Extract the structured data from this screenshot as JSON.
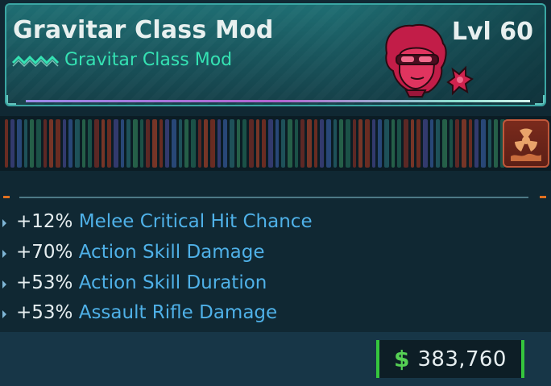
{
  "item": {
    "name": "Gravitar Class Mod",
    "type_label": "Gravitar Class Mod",
    "level_text": "Lvl 60"
  },
  "icons": {
    "rarity": "rarity-chevrons-icon",
    "portrait": "gravitar-portrait-icon",
    "element": "radiation-element-icon",
    "currency": "dollar-icon"
  },
  "stats": [
    {
      "value": "+12%",
      "label": "Melee Critical Hit Chance"
    },
    {
      "value": "+70%",
      "label": "Action Skill Damage"
    },
    {
      "value": "+53%",
      "label": "Action Skill Duration"
    },
    {
      "value": "+53%",
      "label": "Assault Rifle Damage"
    }
  ],
  "price": {
    "symbol": "$",
    "amount": "383,760"
  },
  "colors": {
    "header": "#1f6e73",
    "subtitle": "#35e2b3",
    "stat_label": "#4fb1e8",
    "price_border": "#35c63d",
    "accent_orange": "#e0701f",
    "portrait": "#d0234e"
  }
}
